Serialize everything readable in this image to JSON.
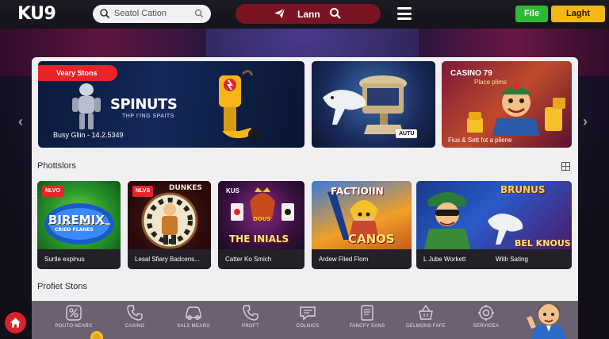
{
  "header": {
    "logo": "KU9",
    "search_placeholder": "Seatol Cation",
    "center_label": "Lann",
    "file_button": "File",
    "laght_button": "Laght"
  },
  "banners": [
    {
      "ribbon": "Veary Stons",
      "title": "SPINUTS",
      "subtitle": "THP I'ING SPAITS",
      "footer": "Busy Gliin - 14.2.5349"
    },
    {
      "tag": "AUTU"
    },
    {
      "title": "CASINO 79",
      "subtitle": "Place plims",
      "footer": "Fius & Sett fot a pliene"
    }
  ],
  "sections": {
    "games_title": "Phottslors",
    "profiet_title": "Profiet Stons"
  },
  "games": [
    {
      "badge": "NLVO",
      "art_text": "BIREMIX",
      "art_sub": "CRIED PLANES",
      "caption": "Surtle expinus"
    },
    {
      "badge": "NLVS",
      "art_text": "DUNKES",
      "caption": "Lesal Sfiary Badcens..."
    },
    {
      "badge": "KUS",
      "art_text": "THE INIALS",
      "art_sub": "DOUS",
      "caption": "Catter Ko Smich"
    },
    {
      "art_text": "FACTIOIIN",
      "art_sub": "CANOS",
      "caption": "Ardew Flied Flom"
    },
    {
      "art_text": "BRUNUS",
      "art_sub": "BEL KNOUS",
      "caption": "L Jube Workett"
    },
    {
      "caption": "Witlr Sating"
    }
  ],
  "bottom_nav": [
    {
      "label": "POUTO NEARS",
      "icon": "percent-icon"
    },
    {
      "label": "CASINO",
      "icon": "phone-icon"
    },
    {
      "label": "SALS MEARU",
      "icon": "car-icon"
    },
    {
      "label": "PROFT",
      "icon": "phone-icon"
    },
    {
      "label": "COLNICS",
      "icon": "chat-icon"
    },
    {
      "label": "FANCFY SANS",
      "icon": "document-icon"
    },
    {
      "label": "GELMONS FAFE",
      "icon": "basket-icon"
    },
    {
      "label": "SERVICEA",
      "icon": "gear-icon"
    }
  ],
  "colors": {
    "accent_red": "#e8232a",
    "file_green": "#2dba36",
    "laght_yellow": "#f5b618",
    "center_pill": "#7a1422"
  }
}
